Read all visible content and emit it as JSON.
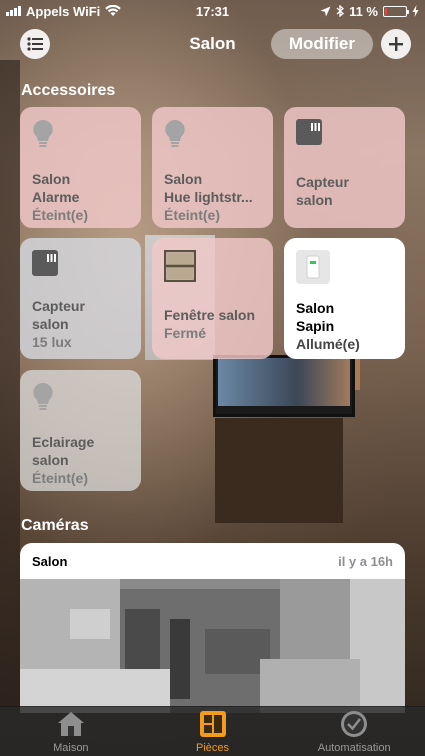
{
  "status_bar": {
    "carrier": "Appels WiFi",
    "time": "17:31",
    "battery": "11 %",
    "battery_level": 0.11
  },
  "nav": {
    "title": "Salon",
    "modifier_label": "Modifier",
    "menu_icon": "list-icon",
    "add_icon": "plus-icon"
  },
  "accessories": {
    "section_title": "Accessoires",
    "tiles": [
      {
        "icon": "bulb-icon",
        "name_line1": "Salon",
        "name_line2": "Alarme",
        "status": "Éteint(e)"
      },
      {
        "icon": "bulb-icon",
        "name_line1": "Salon",
        "name_line2": "Hue lightstr...",
        "status": "Éteint(e)"
      },
      {
        "icon": "sensor-icon",
        "name_line1": "Capteur",
        "name_line2": "salon",
        "status": ""
      },
      {
        "icon": "sensor-icon",
        "name_line1": "Capteur",
        "name_line2": "salon",
        "status": "15 lux"
      },
      {
        "icon": "window-icon",
        "name_line1": "Fenêtre salon",
        "name_line2": "",
        "status": "Fermé"
      },
      {
        "icon": "switch-icon",
        "name_line1": "Salon",
        "name_line2": "Sapin",
        "status": "Allumé(e)"
      },
      {
        "icon": "bulb-icon",
        "name_line1": "Eclairage",
        "name_line2": "salon",
        "status": "Éteint(e)"
      }
    ]
  },
  "cameras": {
    "section_title": "Caméras",
    "card": {
      "name": "Salon",
      "time": "il y a 16h"
    }
  },
  "tabbar": {
    "tabs": [
      {
        "label": "Maison",
        "icon": "house-icon",
        "active": false
      },
      {
        "label": "Pièces",
        "icon": "rooms-icon",
        "active": true
      },
      {
        "label": "Automatisation",
        "icon": "clock-check-icon",
        "active": false
      }
    ],
    "active_color": "#f29b1d"
  }
}
